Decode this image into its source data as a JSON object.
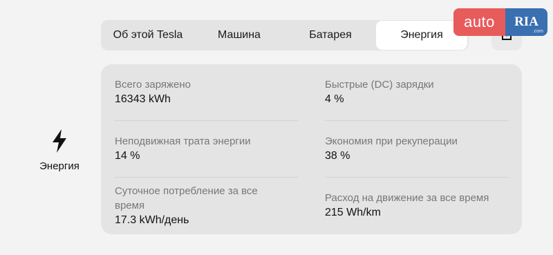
{
  "tabs": [
    {
      "label": "Об этой Tesla"
    },
    {
      "label": "Машина"
    },
    {
      "label": "Батарея"
    },
    {
      "label": "Энергия",
      "active": true
    }
  ],
  "watermark": {
    "auto": "auto",
    "ria": "RIA",
    "ria_small": ".com"
  },
  "side": {
    "label": "Энергия"
  },
  "stats": [
    {
      "label": "Всего заряжено",
      "value": "16343  kWh"
    },
    {
      "label": "Быстрые (DC) зарядки",
      "value": "4 %"
    },
    {
      "label": "Неподвижная трата энергии",
      "value": "14 %"
    },
    {
      "label": "Экономия при рекуперации",
      "value": "38 %"
    },
    {
      "label": "Суточное потребление за все время",
      "value": "17.3 kWh/день"
    },
    {
      "label": "Расход на движение за все время",
      "value": "215 Wh/km"
    }
  ],
  "colors": {
    "active_tab": "#ffffff",
    "panel": "#e4e4e4",
    "background": "#f3f3f3",
    "auto_badge": "#e85b5b",
    "ria_badge": "#3a6fb0"
  }
}
